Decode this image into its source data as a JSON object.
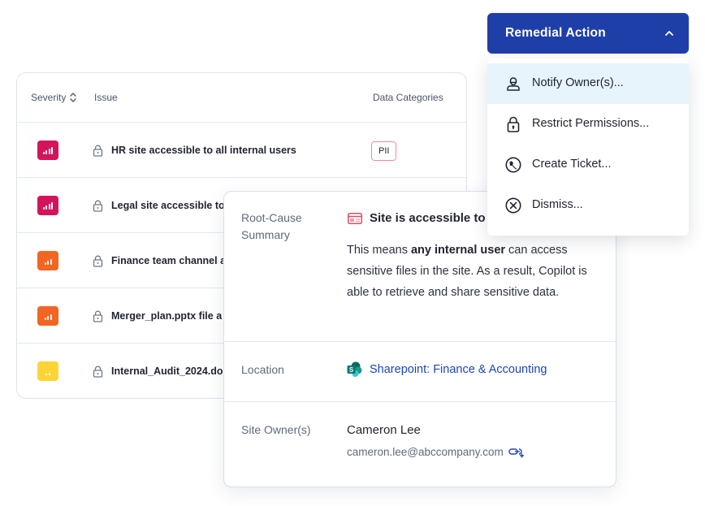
{
  "colors": {
    "critical": "#d4145a",
    "high": "#f26522",
    "medium": "#fcd535",
    "primary": "#1f3fa8",
    "link": "#1b47b4"
  },
  "table": {
    "headers": {
      "severity": "Severity",
      "issue": "Issue",
      "data_categories": "Data Categories"
    },
    "rows": [
      {
        "severity": "critical",
        "issue": "HR site accessible to all internal users",
        "category": "PII"
      },
      {
        "severity": "critical",
        "issue": "Legal site accessible to",
        "category": ""
      },
      {
        "severity": "high",
        "issue": "Finance team channel a",
        "category": ""
      },
      {
        "severity": "high",
        "issue": "Merger_plan.pptx file a",
        "category": ""
      },
      {
        "severity": "medium",
        "issue": "Internal_Audit_2024.do",
        "category": ""
      }
    ]
  },
  "detail": {
    "root_cause": {
      "label": "Root-Cause Summary",
      "title": "Site is accessible to",
      "body_pre": "This means ",
      "body_bold": "any internal user",
      "body_post": " can access sensitive files in the site. As a result, Copilot is able to retrieve and share sensitive data."
    },
    "location": {
      "label": "Location",
      "value": "Sharepoint: Finance & Accounting"
    },
    "owner": {
      "label": "Site Owner(s)",
      "name": "Cameron Lee",
      "email": "cameron.lee@abccompany.com"
    }
  },
  "remedial": {
    "button_label": "Remedial Action",
    "items": [
      {
        "label": "Notify Owner(s)...",
        "icon": "person-icon"
      },
      {
        "label": "Restrict Permissions...",
        "icon": "lock-icon"
      },
      {
        "label": "Create Ticket...",
        "icon": "wrench-icon"
      },
      {
        "label": "Dismiss...",
        "icon": "close-circle-icon"
      }
    ]
  }
}
